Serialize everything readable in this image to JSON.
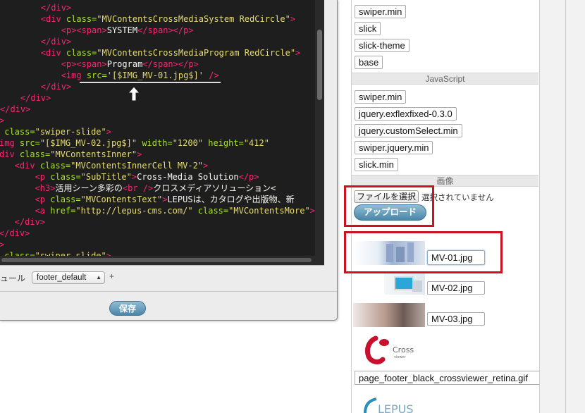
{
  "editor": {
    "code_lines": [
      [
        [
          "k-plain",
          "        "
        ],
        [
          "k-tag",
          "</div>"
        ]
      ],
      [
        [
          "k-plain",
          "        "
        ],
        [
          "k-tag",
          "<div "
        ],
        [
          "k-attr",
          "class="
        ],
        [
          "k-str",
          "\"MVContentsCrossMediaSystem RedCircle\""
        ],
        [
          "k-tag",
          ">"
        ]
      ],
      [
        [
          "k-plain",
          "            "
        ],
        [
          "k-tag",
          "<p><span>"
        ],
        [
          "k-plain",
          "SYSTEM"
        ],
        [
          "k-tag",
          "</span></p>"
        ]
      ],
      [
        [
          "k-plain",
          "        "
        ],
        [
          "k-tag",
          "</div>"
        ]
      ],
      [
        [
          "k-plain",
          "        "
        ],
        [
          "k-tag",
          "<div "
        ],
        [
          "k-attr",
          "class="
        ],
        [
          "k-str",
          "\"MVContentsCrossMediaProgram RedCircle\""
        ],
        [
          "k-tag",
          ">"
        ]
      ],
      [
        [
          "k-plain",
          "            "
        ],
        [
          "k-tag",
          "<p><span>"
        ],
        [
          "k-plain",
          "Program"
        ],
        [
          "k-tag",
          "</span></p>"
        ]
      ],
      [
        [
          "k-plain",
          "            "
        ],
        [
          "k-tag",
          "<img "
        ],
        [
          "k-attr",
          "src="
        ],
        [
          "k-str",
          "'[$IMG_MV-01.jpg$]'"
        ],
        [
          "k-tag",
          " />"
        ]
      ],
      [
        [
          "k-plain",
          "        "
        ],
        [
          "k-tag",
          "</div>"
        ]
      ],
      [
        [
          "k-plain",
          "    "
        ],
        [
          "k-tag",
          "</div>"
        ]
      ],
      [
        [
          "k-tag",
          "</div>"
        ]
      ],
      [
        [
          "k-tag",
          ">"
        ]
      ],
      [
        [
          "k-plain",
          " "
        ],
        [
          "k-attr",
          "class="
        ],
        [
          "k-str",
          "\"swiper-slide\""
        ],
        [
          "k-tag",
          ">"
        ]
      ],
      [
        [
          "k-tag",
          "img "
        ],
        [
          "k-attr",
          "src="
        ],
        [
          "k-str",
          "\"[$IMG_MV-02.jpg$]\""
        ],
        [
          "k-attr",
          " width="
        ],
        [
          "k-str",
          "\"1200\""
        ],
        [
          "k-attr",
          " height="
        ],
        [
          "k-str",
          "\"412\""
        ]
      ],
      [
        [
          "k-tag",
          "div "
        ],
        [
          "k-attr",
          "class="
        ],
        [
          "k-str",
          "\"MVContentsInner\""
        ],
        [
          "k-tag",
          ">"
        ]
      ],
      [
        [
          "k-plain",
          "   "
        ],
        [
          "k-tag",
          "<div "
        ],
        [
          "k-attr",
          "class="
        ],
        [
          "k-str",
          "\"MVContentsInnerCell MV-2\""
        ],
        [
          "k-tag",
          ">"
        ]
      ],
      [
        [
          "k-plain",
          "       "
        ],
        [
          "k-tag",
          "<p "
        ],
        [
          "k-attr",
          "class="
        ],
        [
          "k-str",
          "\"SubTitle\""
        ],
        [
          "k-tag",
          ">"
        ],
        [
          "k-plain",
          "Cross-Media Solution"
        ],
        [
          "k-tag",
          "</p>"
        ]
      ],
      [
        [
          "k-plain",
          "       "
        ],
        [
          "k-tag",
          "<h3>"
        ],
        [
          "k-plain",
          "活用シーン多彩の"
        ],
        [
          "k-tag",
          "<br />"
        ],
        [
          "k-plain",
          "クロスメディアソリューション<"
        ]
      ],
      [
        [
          "k-plain",
          "       "
        ],
        [
          "k-tag",
          "<p "
        ],
        [
          "k-attr",
          "class="
        ],
        [
          "k-str",
          "\"MVContentsText\""
        ],
        [
          "k-tag",
          ">"
        ],
        [
          "k-plain",
          "LEPUSは、カタログや出版物、新"
        ]
      ],
      [
        [
          "k-plain",
          "       "
        ],
        [
          "k-tag",
          "<a "
        ],
        [
          "k-attr",
          "href="
        ],
        [
          "k-str",
          "\"http://lepus-cms.com/\""
        ],
        [
          "k-attr",
          " class="
        ],
        [
          "k-str",
          "\"MVContentsMore\""
        ],
        [
          "k-tag",
          ">"
        ]
      ],
      [
        [
          "k-plain",
          "   "
        ],
        [
          "k-tag",
          "</div>"
        ]
      ],
      [
        [
          "k-tag",
          "</div>"
        ]
      ],
      [
        [
          "k-tag",
          ">"
        ]
      ],
      [
        [
          "k-plain",
          " "
        ],
        [
          "k-attr",
          "class="
        ],
        [
          "k-str",
          "\"swiper-slide\""
        ],
        [
          "k-tag",
          ">"
        ]
      ]
    ],
    "bottom_label": "ュール",
    "footer_select_value": "footer_default",
    "add_symbol": "+",
    "save_label": "保存"
  },
  "assets": {
    "css_files": [
      "swiper.min",
      "slick",
      "slick-theme",
      "base"
    ],
    "js_section_label": "JavaScript",
    "js_files": [
      "swiper.min",
      "jquery.exflexfixed-0.3.0",
      "jquery.customSelect.min",
      "swiper.jquery.min",
      "slick.min"
    ],
    "image_section_label": "画像",
    "choose_file_label": "ファイルを選択",
    "no_file_text": "選択されていません",
    "upload_label": "アップロード",
    "images": [
      "MV-01.jpg",
      "MV-02.jpg",
      "MV-03.jpg"
    ],
    "footer_image_name": "page_footer_black_crossviewer_retina.gif",
    "logo_cross_text": "Cross",
    "logo_viewer_text": "viewer",
    "logo_lepus_text": "LEPUS"
  },
  "colors": {
    "highlight_red": "#cc1122",
    "button_blue": "#4a86a8",
    "editor_bg": "#1e1e1e"
  }
}
